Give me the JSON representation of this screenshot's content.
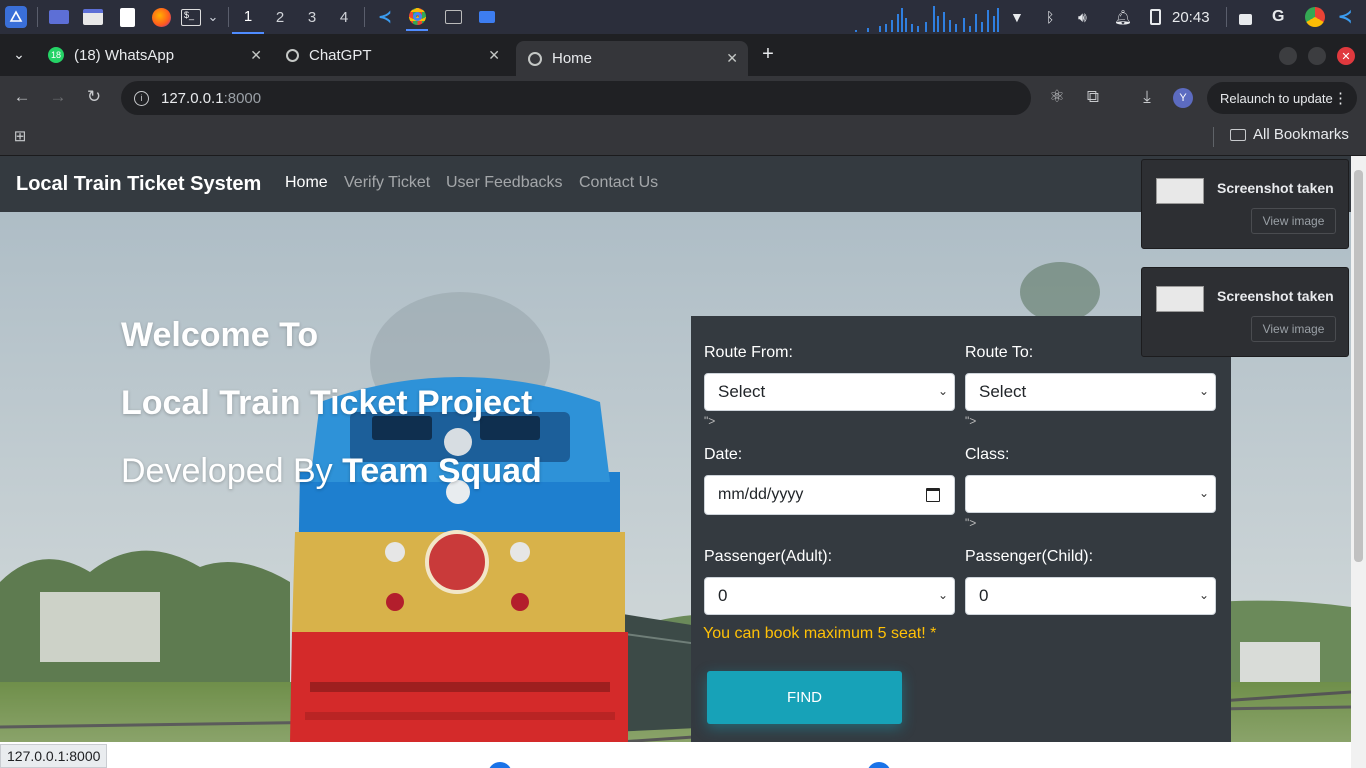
{
  "taskbar": {
    "workspaces": [
      "1",
      "2",
      "3",
      "4"
    ],
    "clock": "20:43"
  },
  "tabs": [
    {
      "label": "(18) WhatsApp",
      "badge": "18"
    },
    {
      "label": "ChatGPT"
    },
    {
      "label": "Home"
    }
  ],
  "toolbar": {
    "url_host": "127.0.0.1",
    "url_port": ":8000",
    "relaunch_label": "Relaunch to update",
    "avatar_letter": "Y"
  },
  "bookmarks": {
    "all_label": "All Bookmarks"
  },
  "navbar": {
    "brand": "Local Train Ticket System",
    "links": [
      "Home",
      "Verify Ticket",
      "User Feedbacks",
      "Contact Us"
    ]
  },
  "hero": {
    "line1": "Welcome To",
    "line2": "Local Train Ticket Project",
    "line3_prefix": "Developed By ",
    "line3_team": "Team Squad"
  },
  "form": {
    "route_from_label": "Route From:",
    "route_from_value": "Select",
    "route_to_label": "Route To:",
    "route_to_value": "Select",
    "stray_text": "\">",
    "date_label": "Date:",
    "date_placeholder": "mm/dd/yyyy",
    "class_label": "Class:",
    "class_value": "",
    "adult_label": "Passenger(Adult):",
    "adult_value": "0",
    "child_label": "Passenger(Child):",
    "child_value": "0",
    "warning": "You can book maximum 5 seat! *",
    "find_label": "FIND"
  },
  "notifications": [
    {
      "title": "Screenshot taken",
      "button": "View image"
    },
    {
      "title": "Screenshot taken",
      "button": "View image"
    }
  ],
  "status_url": "127.0.0.1:8000",
  "colors": {
    "navbar": "#343a40",
    "accent_button": "#17a2b8",
    "warning_text": "#ffc107"
  }
}
